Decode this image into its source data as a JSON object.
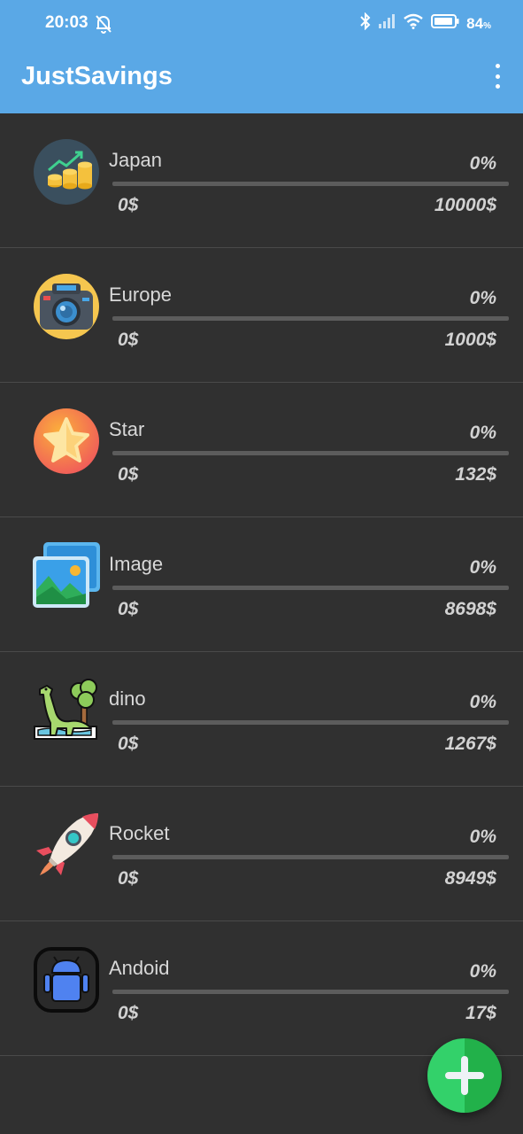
{
  "status": {
    "time": "20:03",
    "battery": "84",
    "battery_unit": "%"
  },
  "app": {
    "title": "JustSavings"
  },
  "goals": [
    {
      "name": "Japan",
      "percent": "0%",
      "current": "0$",
      "goal": "10000$",
      "progress": 0,
      "icon": "chart-coins-icon"
    },
    {
      "name": "Europe",
      "percent": "0%",
      "current": "0$",
      "goal": "1000$",
      "progress": 0,
      "icon": "camera-icon"
    },
    {
      "name": "Star",
      "percent": "0%",
      "current": "0$",
      "goal": "132$",
      "progress": 0,
      "icon": "star-icon"
    },
    {
      "name": "Image",
      "percent": "0%",
      "current": "0$",
      "goal": "8698$",
      "progress": 0,
      "icon": "image-icon"
    },
    {
      "name": "dino",
      "percent": "0%",
      "current": "0$",
      "goal": "1267$",
      "progress": 0,
      "icon": "dino-icon"
    },
    {
      "name": "Rocket",
      "percent": "0%",
      "current": "0$",
      "goal": "8949$",
      "progress": 0,
      "icon": "rocket-icon"
    },
    {
      "name": "Andoid",
      "percent": "0%",
      "current": "0$",
      "goal": "17$",
      "progress": 0,
      "icon": "android-icon"
    }
  ],
  "colors": {
    "header": "#5aa8e6",
    "background": "#303030",
    "fab": "#33d16a"
  }
}
